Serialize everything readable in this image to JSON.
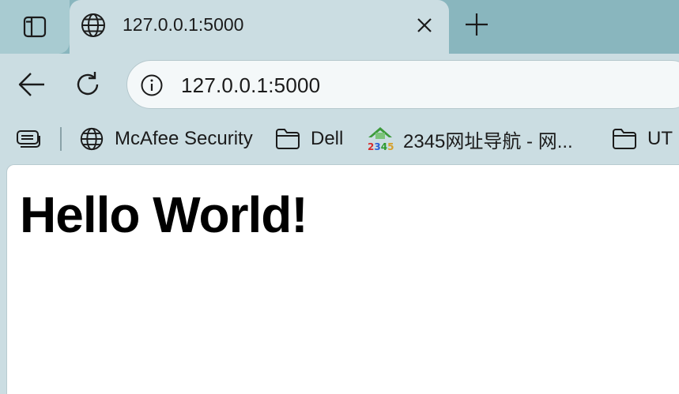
{
  "browser": {
    "tab": {
      "title": "127.0.0.1:5000"
    },
    "address_bar": {
      "url": "127.0.0.1:5000"
    },
    "bookmarks": [
      {
        "label": "McAfee Security",
        "icon": "globe-icon"
      },
      {
        "label": "Dell",
        "icon": "folder-icon"
      },
      {
        "label": "2345网址导航 - 网...",
        "icon": "2345-logo-icon"
      },
      {
        "label": "UT",
        "icon": "folder-icon"
      }
    ]
  },
  "page": {
    "heading": "Hello World!"
  },
  "logo_2345": {
    "digits": "2345"
  }
}
